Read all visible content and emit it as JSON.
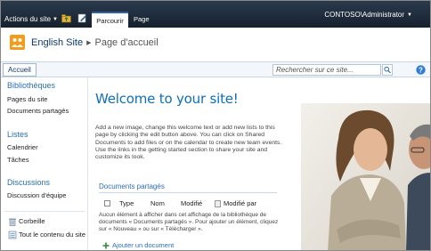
{
  "ribbon": {
    "site_actions": "Actions du site",
    "tabs": [
      {
        "label": "Parcourir",
        "selected": true
      },
      {
        "label": "Page",
        "selected": false
      }
    ],
    "user": "CONTOSO\\Administrator"
  },
  "title_area": {
    "site_title": "English Site",
    "page_title": "Page d'accueil"
  },
  "topnav": {
    "home": "Accueil",
    "search_placeholder": "Rechercher sur ce site..."
  },
  "leftnav": {
    "sections": [
      {
        "heading": "Bibliothèques",
        "items": [
          "Pages du site",
          "Documents partagés"
        ]
      },
      {
        "heading": "Listes",
        "items": [
          "Calendrier",
          "Tâches"
        ]
      },
      {
        "heading": "Discussions",
        "items": [
          "Discussion d'équipe"
        ]
      }
    ],
    "bottom": [
      {
        "label": "Corbeille",
        "icon": "recycle-bin-icon"
      },
      {
        "label": "Tout le contenu du site",
        "icon": "all-content-icon"
      }
    ]
  },
  "main": {
    "welcome": "Welcome to your site!",
    "intro": "Add a new image, change this welcome text or add new lists to this page by clicking the edit button above. You can click on Shared Documents to add files or on the calendar to create new team events. Use the links in the getting started section to share your site and customize its look.",
    "documents": {
      "title": "Documents partagés",
      "columns": [
        "Type",
        "Nom",
        "Modifié",
        "Modifié par"
      ],
      "empty_message": "Aucun élément à afficher dans cet affichage de la bibliothèque de documents « Documents partagés ». Pour ajouter un élément, cliquez sur « Nouveau » ou sur « Télécharger ».",
      "add_link": "Ajouter un document"
    }
  },
  "colors": {
    "ribbon_bg": "#1f2d3d",
    "accent_blue": "#0f6fb8",
    "link_blue": "#2a6fb4",
    "logo_orange": "#f29b1d"
  }
}
